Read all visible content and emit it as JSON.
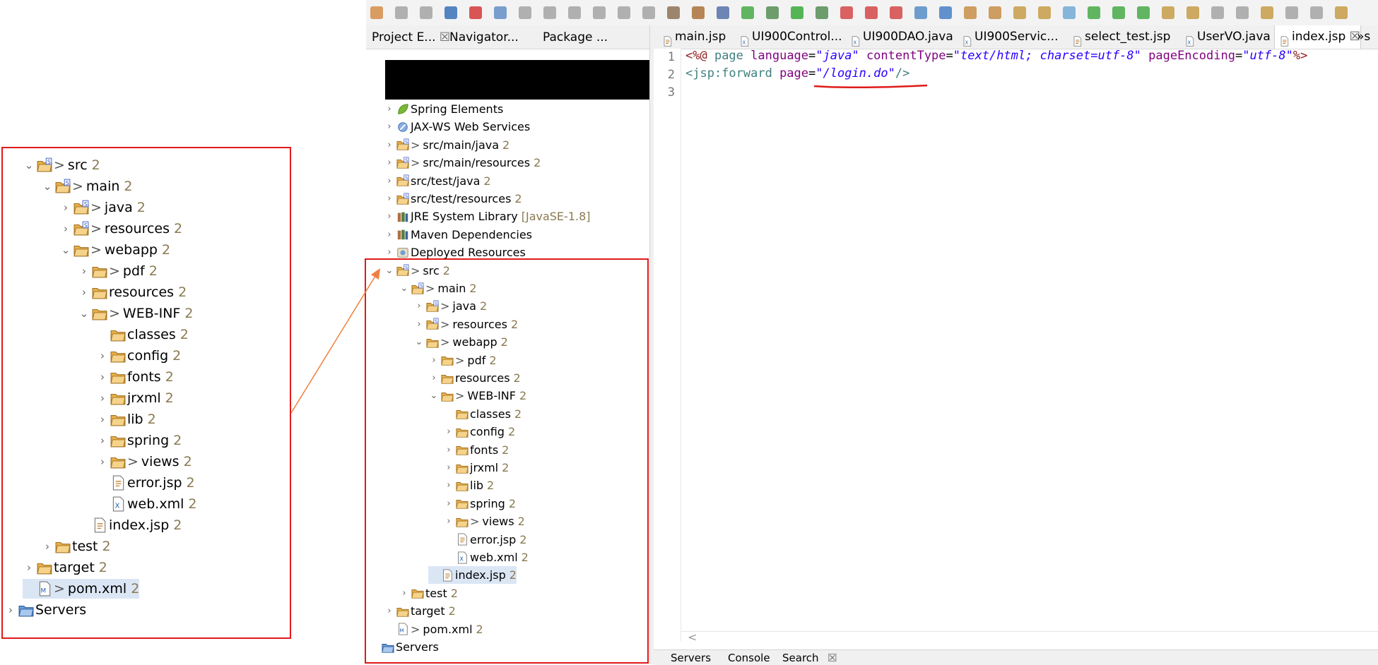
{
  "zoom_tree": [
    {
      "indent": 0,
      "chev": "v",
      "icon": "src-folder-icon",
      "gt": true,
      "label": "src",
      "count": "2"
    },
    {
      "indent": 1,
      "chev": "v",
      "icon": "src-folder-icon",
      "gt": true,
      "label": "main",
      "count": "2"
    },
    {
      "indent": 2,
      "chev": ">",
      "icon": "src-folder-icon",
      "gt": true,
      "label": "java",
      "count": "2"
    },
    {
      "indent": 2,
      "chev": ">",
      "icon": "src-folder-icon",
      "gt": true,
      "label": "resources",
      "count": "2"
    },
    {
      "indent": 2,
      "chev": "v",
      "icon": "folder-icon",
      "gt": true,
      "label": "webapp",
      "count": "2"
    },
    {
      "indent": 3,
      "chev": ">",
      "icon": "folder-icon",
      "gt": true,
      "label": "pdf",
      "count": "2"
    },
    {
      "indent": 3,
      "chev": ">",
      "icon": "folder-icon",
      "gt": false,
      "label": "resources",
      "count": "2"
    },
    {
      "indent": 3,
      "chev": "v",
      "icon": "folder-icon",
      "gt": true,
      "label": "WEB-INF",
      "count": "2"
    },
    {
      "indent": 4,
      "chev": "",
      "icon": "folder-icon",
      "gt": false,
      "label": "classes",
      "count": "2"
    },
    {
      "indent": 4,
      "chev": ">",
      "icon": "folder-icon",
      "gt": false,
      "label": "config",
      "count": "2"
    },
    {
      "indent": 4,
      "chev": ">",
      "icon": "folder-icon",
      "gt": false,
      "label": "fonts",
      "count": "2"
    },
    {
      "indent": 4,
      "chev": ">",
      "icon": "folder-icon",
      "gt": false,
      "label": "jrxml",
      "count": "2"
    },
    {
      "indent": 4,
      "chev": ">",
      "icon": "folder-icon",
      "gt": false,
      "label": "lib",
      "count": "2"
    },
    {
      "indent": 4,
      "chev": ">",
      "icon": "folder-icon",
      "gt": false,
      "label": "spring",
      "count": "2"
    },
    {
      "indent": 4,
      "chev": ">",
      "icon": "folder-icon",
      "gt": true,
      "label": "views",
      "count": "2"
    },
    {
      "indent": 4,
      "chev": "",
      "icon": "jsp-file-icon",
      "gt": false,
      "label": "error.jsp",
      "count": "2"
    },
    {
      "indent": 4,
      "chev": "",
      "icon": "xml-file-icon",
      "gt": false,
      "label": "web.xml",
      "count": "2"
    },
    {
      "indent": 3,
      "chev": "",
      "icon": "jsp-file-icon",
      "gt": false,
      "label": "index.jsp",
      "count": "2"
    },
    {
      "indent": 1,
      "chev": ">",
      "icon": "folder-icon",
      "gt": false,
      "label": "test",
      "count": "2"
    },
    {
      "indent": 0,
      "chev": ">",
      "icon": "folder-icon",
      "gt": false,
      "label": "target",
      "count": "2"
    },
    {
      "indent": 0,
      "chev": "",
      "icon": "maven-file-icon",
      "gt": true,
      "label": "pom.xml",
      "count": "2",
      "selected": true
    },
    {
      "indent": -1,
      "chev": ">",
      "icon": "servers-folder-icon",
      "gt": false,
      "label": "Servers",
      "count": ""
    }
  ],
  "left_tabs": [
    {
      "label": "Project E...",
      "close": "☒"
    },
    {
      "label": "Navigator...",
      "close": ""
    },
    {
      "label": "Package ...",
      "close": ""
    }
  ],
  "project_tree": [
    {
      "indent": 0,
      "chev": ">",
      "icon": "spring-icon",
      "gt": false,
      "label": "Spring Elements",
      "count": ""
    },
    {
      "indent": 0,
      "chev": ">",
      "icon": "webservice-icon",
      "gt": false,
      "label": "JAX-WS Web Services",
      "count": ""
    },
    {
      "indent": 0,
      "chev": ">",
      "icon": "src-folder-icon",
      "gt": true,
      "label": "src/main/java",
      "count": "2"
    },
    {
      "indent": 0,
      "chev": ">",
      "icon": "src-folder-icon",
      "gt": true,
      "label": "src/main/resources",
      "count": "2"
    },
    {
      "indent": 0,
      "chev": ">",
      "icon": "src-folder-icon",
      "gt": false,
      "label": "src/test/java",
      "count": "2"
    },
    {
      "indent": 0,
      "chev": ">",
      "icon": "src-folder-icon",
      "gt": false,
      "label": "src/test/resources",
      "count": "2"
    },
    {
      "indent": 0,
      "chev": ">",
      "icon": "library-icon",
      "gt": false,
      "label": "JRE System Library",
      "count": "",
      "dim": "[JavaSE-1.8]"
    },
    {
      "indent": 0,
      "chev": ">",
      "icon": "library-icon",
      "gt": false,
      "label": "Maven Dependencies",
      "count": ""
    },
    {
      "indent": 0,
      "chev": ">",
      "icon": "deployed-icon",
      "gt": false,
      "label": "Deployed Resources",
      "count": ""
    },
    {
      "indent": 0,
      "chev": "v",
      "icon": "src-folder-icon",
      "gt": true,
      "label": "src",
      "count": "2"
    },
    {
      "indent": 1,
      "chev": "v",
      "icon": "src-folder-icon",
      "gt": true,
      "label": "main",
      "count": "2"
    },
    {
      "indent": 2,
      "chev": ">",
      "icon": "src-folder-icon",
      "gt": true,
      "label": "java",
      "count": "2"
    },
    {
      "indent": 2,
      "chev": ">",
      "icon": "src-folder-icon",
      "gt": true,
      "label": "resources",
      "count": "2"
    },
    {
      "indent": 2,
      "chev": "v",
      "icon": "folder-icon",
      "gt": true,
      "label": "webapp",
      "count": "2"
    },
    {
      "indent": 3,
      "chev": ">",
      "icon": "folder-icon",
      "gt": true,
      "label": "pdf",
      "count": "2"
    },
    {
      "indent": 3,
      "chev": ">",
      "icon": "folder-icon",
      "gt": false,
      "label": "resources",
      "count": "2"
    },
    {
      "indent": 3,
      "chev": "v",
      "icon": "folder-icon",
      "gt": true,
      "label": "WEB-INF",
      "count": "2"
    },
    {
      "indent": 4,
      "chev": "",
      "icon": "folder-icon",
      "gt": false,
      "label": "classes",
      "count": "2"
    },
    {
      "indent": 4,
      "chev": ">",
      "icon": "folder-icon",
      "gt": false,
      "label": "config",
      "count": "2"
    },
    {
      "indent": 4,
      "chev": ">",
      "icon": "folder-icon",
      "gt": false,
      "label": "fonts",
      "count": "2"
    },
    {
      "indent": 4,
      "chev": ">",
      "icon": "folder-icon",
      "gt": false,
      "label": "jrxml",
      "count": "2"
    },
    {
      "indent": 4,
      "chev": ">",
      "icon": "folder-icon",
      "gt": false,
      "label": "lib",
      "count": "2"
    },
    {
      "indent": 4,
      "chev": ">",
      "icon": "folder-icon",
      "gt": false,
      "label": "spring",
      "count": "2"
    },
    {
      "indent": 4,
      "chev": ">",
      "icon": "folder-icon",
      "gt": true,
      "label": "views",
      "count": "2"
    },
    {
      "indent": 4,
      "chev": "",
      "icon": "jsp-file-icon",
      "gt": false,
      "label": "error.jsp",
      "count": "2"
    },
    {
      "indent": 4,
      "chev": "",
      "icon": "xml-file-icon",
      "gt": false,
      "label": "web.xml",
      "count": "2"
    },
    {
      "indent": 3,
      "chev": "",
      "icon": "jsp-file-icon",
      "gt": false,
      "label": "index.jsp",
      "count": "2",
      "selected": true
    },
    {
      "indent": 1,
      "chev": ">",
      "icon": "folder-icon",
      "gt": false,
      "label": "test",
      "count": "2"
    },
    {
      "indent": 0,
      "chev": ">",
      "icon": "folder-icon",
      "gt": false,
      "label": "target",
      "count": "2"
    },
    {
      "indent": 0,
      "chev": "",
      "icon": "maven-file-icon",
      "gt": true,
      "label": "pom.xml",
      "count": "2"
    },
    {
      "indent": -1,
      "chev": "",
      "icon": "servers-folder-icon",
      "gt": false,
      "label": "Servers",
      "count": ""
    }
  ],
  "editor_tabs": [
    {
      "label": "main.jsp",
      "icon": "jsp",
      "active": false,
      "close": ""
    },
    {
      "label": "UI900Control...",
      "icon": "java",
      "active": false,
      "close": ""
    },
    {
      "label": "UI900DAO.java",
      "icon": "java",
      "active": false,
      "close": ""
    },
    {
      "label": "UI900Servic...",
      "icon": "java",
      "active": false,
      "close": ""
    },
    {
      "label": "select_test.jsp",
      "icon": "jsp",
      "active": false,
      "close": ""
    },
    {
      "label": "UserVO.java",
      "icon": "java",
      "active": false,
      "close": ""
    },
    {
      "label": "index.jsp",
      "icon": "jsp",
      "active": true,
      "close": "☒"
    }
  ],
  "editor_overflow": "»s",
  "line_numbers": [
    "1",
    "2",
    "3"
  ],
  "code": {
    "l1": [
      {
        "t": "<%@ ",
        "c": "dl"
      },
      {
        "t": "page ",
        "c": "kw"
      },
      {
        "t": "language",
        "c": "at"
      },
      {
        "t": "=",
        "c": ""
      },
      {
        "t": "\"java\"",
        "c": "str"
      },
      {
        "t": " contentType",
        "c": "at"
      },
      {
        "t": "=",
        "c": ""
      },
      {
        "t": "\"text/html; charset=utf-8\"",
        "c": "str"
      },
      {
        "t": " pageEncoding",
        "c": "at"
      },
      {
        "t": "=",
        "c": ""
      },
      {
        "t": "\"utf-8\"",
        "c": "str"
      },
      {
        "t": "%>",
        "c": "dl"
      }
    ],
    "l2": [
      {
        "t": "<jsp:forward ",
        "c": "kw"
      },
      {
        "t": "page",
        "c": "at"
      },
      {
        "t": "=",
        "c": ""
      },
      {
        "t": "\"/login.do\"",
        "c": "str"
      },
      {
        "t": "/>",
        "c": "kw"
      }
    ]
  },
  "hscroll_arrow": "<",
  "bottom_tabs": {
    "servers": "Servers",
    "console": "Console",
    "search": "Search",
    "search_close": "☒"
  },
  "colors": {
    "highlight_border": "#e01a1a",
    "arrow": "#f08040",
    "underline": "#e01a1a",
    "folder": "#e8b04a"
  }
}
